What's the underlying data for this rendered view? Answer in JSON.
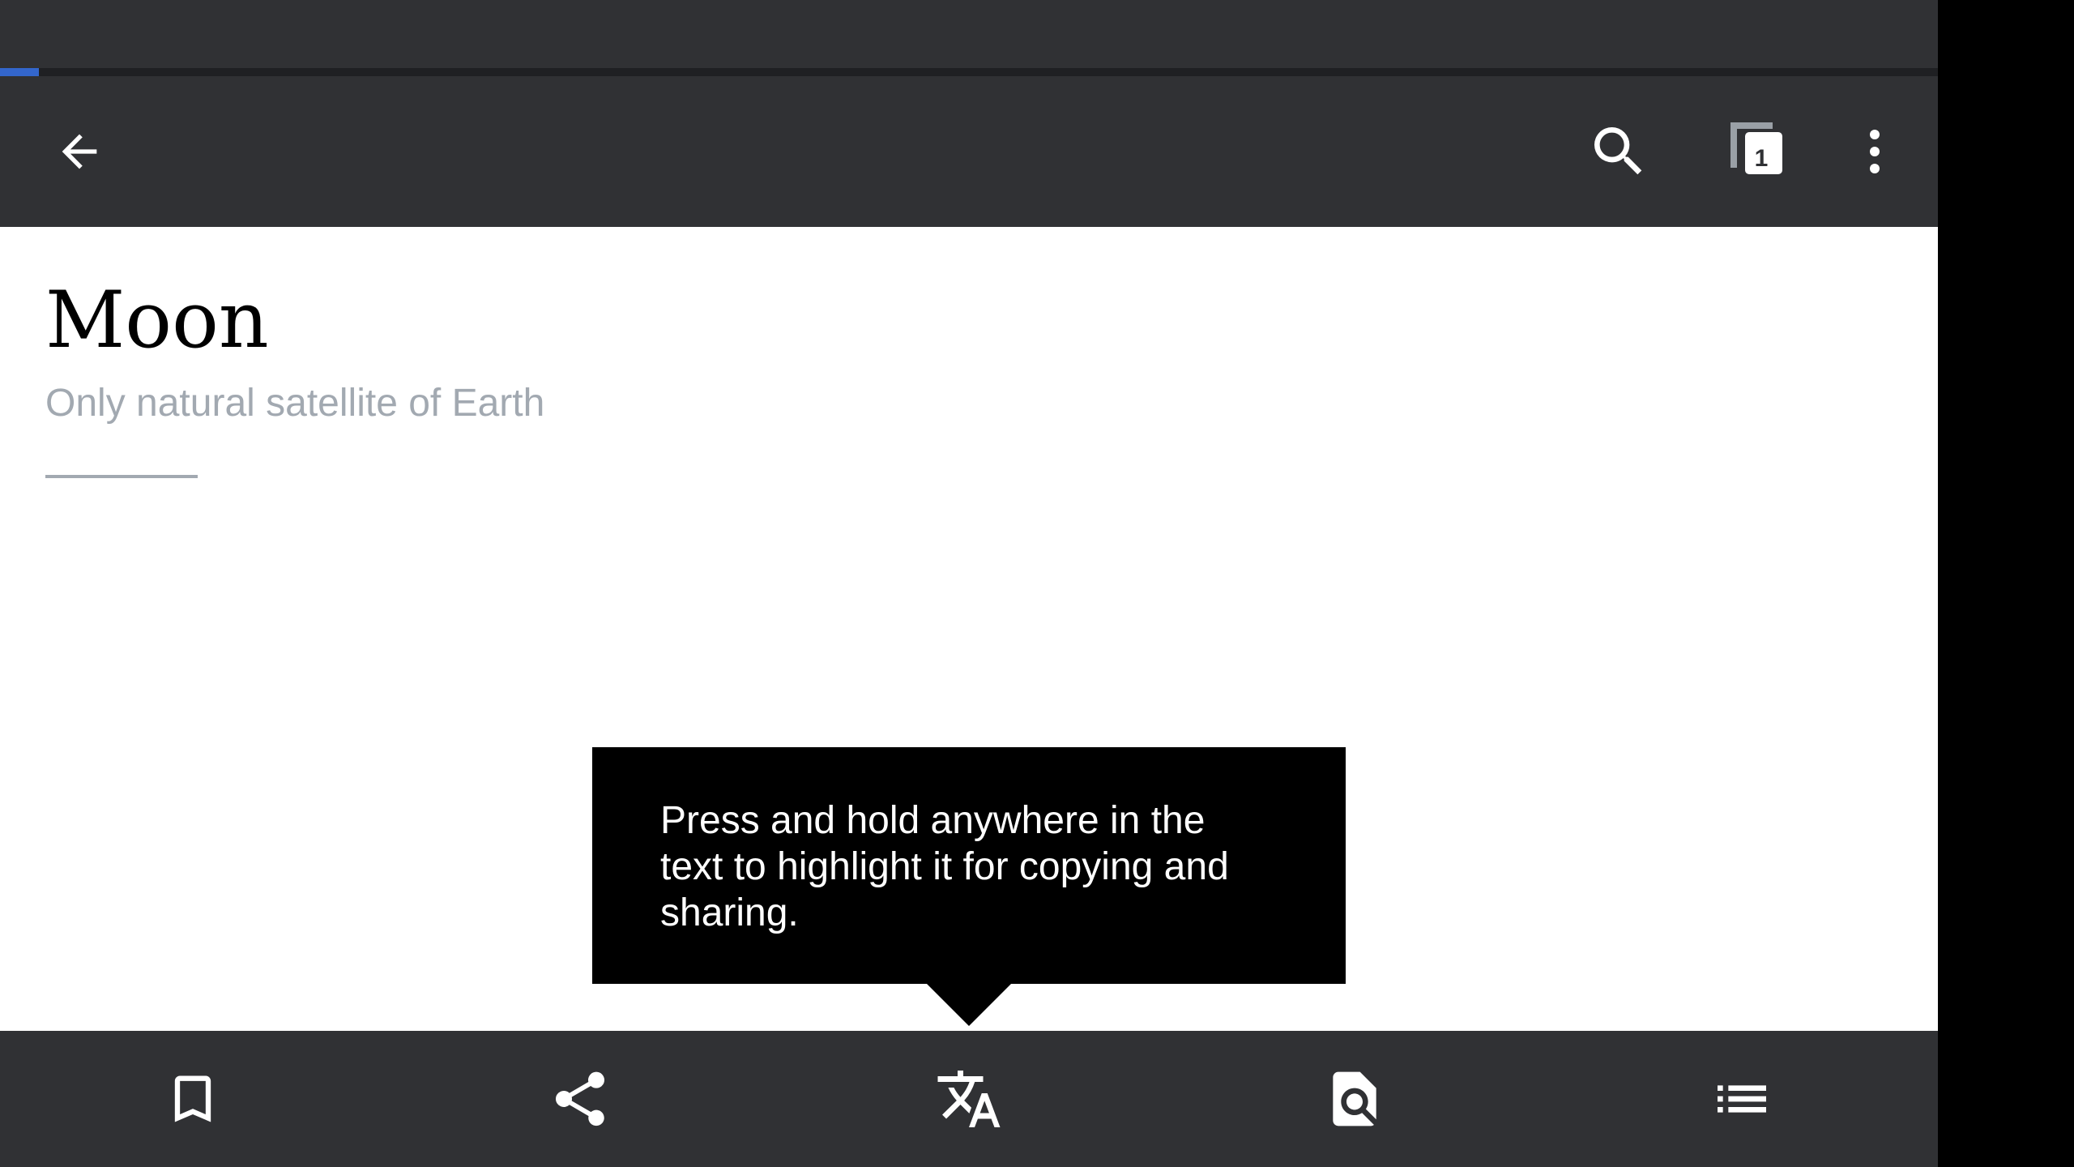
{
  "article": {
    "title": "Moon",
    "description": "Only natural satellite of Earth"
  },
  "toolbar": {
    "back_icon": "arrow-back-icon",
    "search_icon": "search-icon",
    "tabs_icon": "tabs-icon",
    "tab_count": "1",
    "overflow_icon": "more-vert-icon"
  },
  "page_load_progress": 0.02,
  "tooltip": {
    "text": "Press and hold anywhere in the text to highlight it for copying and sharing."
  },
  "bottom_bar": {
    "items": [
      {
        "icon": "bookmark-icon"
      },
      {
        "icon": "share-icon"
      },
      {
        "icon": "translate-icon"
      },
      {
        "icon": "find-in-page-icon"
      },
      {
        "icon": "contents-list-icon"
      }
    ]
  },
  "colors": {
    "bar_background": "#303134",
    "accent": "#3366cc",
    "subtitle_gray": "#a2a9b1",
    "tooltip_background": "#000000"
  }
}
